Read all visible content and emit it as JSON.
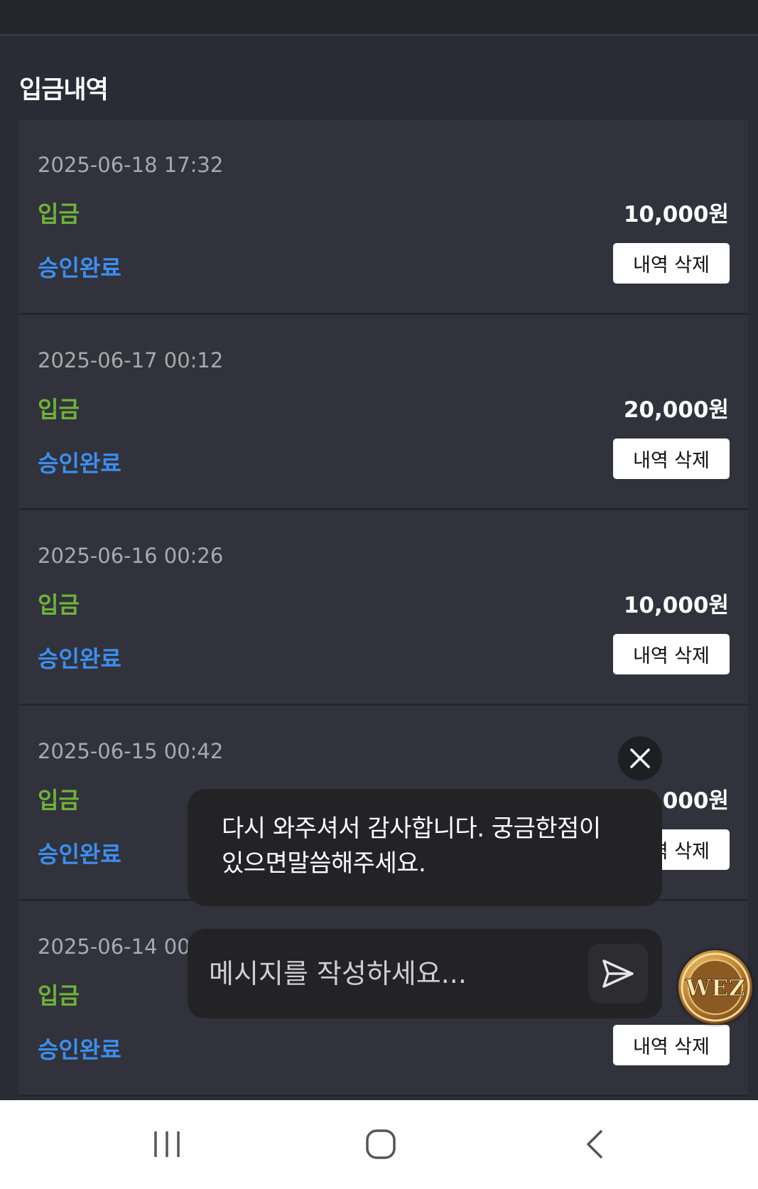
{
  "page": {
    "title": "입금내역"
  },
  "records": [
    {
      "date": "2025-06-18 17:32",
      "type": "입금",
      "amount": "10,000원",
      "status": "승인완료",
      "delete_label": "내역 삭제"
    },
    {
      "date": "2025-06-17 00:12",
      "type": "입금",
      "amount": "20,000원",
      "status": "승인완료",
      "delete_label": "내역 삭제"
    },
    {
      "date": "2025-06-16 00:26",
      "type": "입금",
      "amount": "10,000원",
      "status": "승인완료",
      "delete_label": "내역 삭제"
    },
    {
      "date": "2025-06-15 00:42",
      "type": "입금",
      "amount": "10,000원",
      "status": "승인완료",
      "delete_label": "내역 삭제"
    },
    {
      "date": "2025-06-14 00:1",
      "type": "입금",
      "amount": "",
      "status": "승인완료",
      "delete_label": "내역 삭제"
    }
  ],
  "chat": {
    "message_line1": "다시 와주셔서 감사합니다. 궁금한점이",
    "message_line2": "있으면말씀해주세요.",
    "input_placeholder": "메시지를 작성하세요..."
  },
  "badge": {
    "text": "WEZ"
  },
  "colors": {
    "background": "#2a2b34",
    "card": "#31323b",
    "type_green": "#6fb23a",
    "status_blue": "#3b8ff0",
    "chat_bg": "#232326"
  },
  "icons": {
    "chat_close": "close-icon",
    "chat_send": "send-icon",
    "nav_recents": "recents-icon",
    "nav_home": "home-icon",
    "nav_back": "back-icon"
  }
}
